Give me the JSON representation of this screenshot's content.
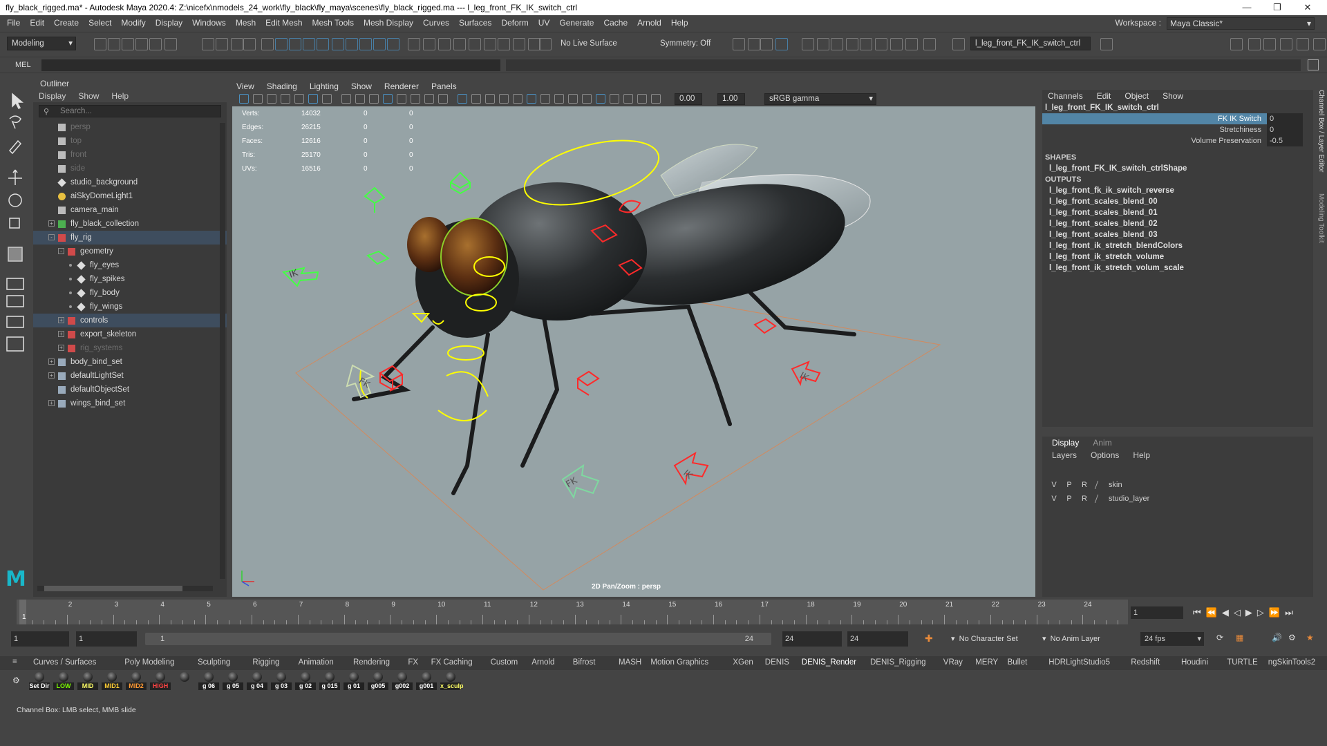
{
  "window": {
    "title": "fly_black_rigged.ma* - Autodesk Maya 2020.4: Z:\\nicefx\\nmodels_24_work\\fly_black\\fly_maya\\scenes\\fly_black_rigged.ma  ---  l_leg_front_FK_IK_switch_ctrl"
  },
  "menubar": {
    "items": [
      "File",
      "Edit",
      "Create",
      "Select",
      "Modify",
      "Display",
      "Windows",
      "Mesh",
      "Edit Mesh",
      "Mesh Tools",
      "Mesh Display",
      "Curves",
      "Surfaces",
      "Deform",
      "UV",
      "Generate",
      "Cache",
      "Arnold",
      "Help"
    ],
    "workspace_label": "Workspace :",
    "workspace_value": "Maya Classic*"
  },
  "statusline": {
    "menuset": "Modeling",
    "live_surface": "No Live Surface",
    "symmetry": "Symmetry: Off",
    "selection_field": "l_leg_front_FK_IK_switch_ctrl"
  },
  "mel": {
    "label": "MEL"
  },
  "outliner": {
    "title": "Outliner",
    "menu": [
      "Display",
      "Show",
      "Help"
    ],
    "search_placeholder": "Search...",
    "items": [
      {
        "label": "persp",
        "indent": 0,
        "icon": "camera",
        "dim": true
      },
      {
        "label": "top",
        "indent": 0,
        "icon": "camera",
        "dim": true
      },
      {
        "label": "front",
        "indent": 0,
        "icon": "camera",
        "dim": true
      },
      {
        "label": "side",
        "indent": 0,
        "icon": "camera",
        "dim": true
      },
      {
        "label": "studio_background",
        "indent": 0,
        "icon": "mesh"
      },
      {
        "label": "aiSkyDomeLight1",
        "indent": 0,
        "icon": "light"
      },
      {
        "label": "camera_main",
        "indent": 0,
        "icon": "camera"
      },
      {
        "label": "fly_black_collection",
        "indent": 0,
        "icon": "collection",
        "expand": "+"
      },
      {
        "label": "fly_rig",
        "indent": 0,
        "icon": "group",
        "expand": "-",
        "selected": true
      },
      {
        "label": "geometry",
        "indent": 1,
        "icon": "group",
        "expand": "-"
      },
      {
        "label": "fly_eyes",
        "indent": 2,
        "icon": "mesh"
      },
      {
        "label": "fly_spikes",
        "indent": 2,
        "icon": "mesh"
      },
      {
        "label": "fly_body",
        "indent": 2,
        "icon": "mesh"
      },
      {
        "label": "fly_wings",
        "indent": 2,
        "icon": "mesh"
      },
      {
        "label": "controls",
        "indent": 1,
        "icon": "group",
        "expand": "+",
        "selected": true
      },
      {
        "label": "export_skeleton",
        "indent": 1,
        "icon": "group",
        "expand": "+"
      },
      {
        "label": "rig_systems",
        "indent": 1,
        "icon": "group",
        "expand": "+",
        "dim": true
      },
      {
        "label": "body_bind_set",
        "indent": 0,
        "icon": "set",
        "expand": "+"
      },
      {
        "label": "defaultLightSet",
        "indent": 0,
        "icon": "set",
        "expand": "+"
      },
      {
        "label": "defaultObjectSet",
        "indent": 0,
        "icon": "set"
      },
      {
        "label": "wings_bind_set",
        "indent": 0,
        "icon": "set",
        "expand": "+"
      }
    ]
  },
  "viewport": {
    "menu": [
      "View",
      "Shading",
      "Lighting",
      "Show",
      "Renderer",
      "Panels"
    ],
    "field_a": "0.00",
    "field_b": "1.00",
    "colorspace": "sRGB gamma",
    "hud": [
      {
        "label": "Verts:",
        "v1": "14032",
        "v2": "0",
        "v3": "0"
      },
      {
        "label": "Edges:",
        "v1": "26215",
        "v2": "0",
        "v3": "0"
      },
      {
        "label": "Faces:",
        "v1": "12616",
        "v2": "0",
        "v3": "0"
      },
      {
        "label": "Tris:",
        "v1": "25170",
        "v2": "0",
        "v3": "0"
      },
      {
        "label": "UVs:",
        "v1": "16516",
        "v2": "0",
        "v3": "0"
      }
    ],
    "camera_label": "2D Pan/Zoom : persp",
    "ik_label": "IK",
    "fk_label": "FK"
  },
  "channelbox": {
    "menu": [
      "Channels",
      "Edit",
      "Object",
      "Show"
    ],
    "node": "l_leg_front_FK_IK_switch_ctrl",
    "attrs": [
      {
        "name": "FK IK Switch",
        "value": "0"
      },
      {
        "name": "Stretchiness",
        "value": "0"
      },
      {
        "name": "Volume Preservation",
        "value": "-0.5"
      }
    ],
    "shapes_header": "SHAPES",
    "shape": "l_leg_front_FK_IK_switch_ctrlShape",
    "outputs_header": "OUTPUTS",
    "outputs": [
      "l_leg_front_fk_ik_switch_reverse",
      "l_leg_front_scales_blend_00",
      "l_leg_front_scales_blend_01",
      "l_leg_front_scales_blend_02",
      "l_leg_front_scales_blend_03",
      "l_leg_front_ik_stretch_blendColors",
      "l_leg_front_ik_stretch_volume",
      "l_leg_front_ik_stretch_volum_scale"
    ]
  },
  "layers": {
    "tabs": [
      "Display",
      "Anim"
    ],
    "menu": [
      "Layers",
      "Options",
      "Help"
    ],
    "rows": [
      {
        "v": "V",
        "p": "P",
        "r": "R",
        "name": "skin"
      },
      {
        "v": "V",
        "p": "P",
        "r": "R",
        "name": "studio_layer"
      }
    ]
  },
  "sidetabs": [
    "Channel Box / Layer Editor",
    "Modeling Toolkit"
  ],
  "timeslider": {
    "ticks": [
      "1",
      "2",
      "3",
      "4",
      "5",
      "6",
      "7",
      "8",
      "9",
      "10",
      "11",
      "12",
      "13",
      "14",
      "15",
      "16",
      "17",
      "18",
      "19",
      "20",
      "21",
      "22",
      "23",
      "24"
    ],
    "current": "1",
    "current_field": "1"
  },
  "range": {
    "start": "1",
    "anim_start": "1",
    "slider_start": "1",
    "slider_end": "24",
    "anim_end": "24",
    "end": "24",
    "character_set": "No Character Set",
    "anim_layer": "No Anim Layer",
    "fps": "24 fps"
  },
  "shelf": {
    "tabs": [
      "Curves / Surfaces",
      "Poly Modeling",
      "Sculpting",
      "Rigging",
      "Animation",
      "Rendering",
      "FX",
      "FX Caching",
      "Custom",
      "Arnold",
      "Bifrost",
      "MASH",
      "Motion Graphics",
      "XGen",
      "DENIS",
      "DENIS_Render",
      "DENIS_Rigging",
      "VRay",
      "MERY",
      "Bullet",
      "HDRLightStudio5",
      "Redshift",
      "Houdini",
      "TURTLE",
      "ngSkinTools2"
    ],
    "active_tab": "DENIS_Render",
    "buttons": [
      {
        "label": "Set Dir",
        "color": "#ffffff"
      },
      {
        "label": "LOW",
        "color": "#7cfc00"
      },
      {
        "label": "MID",
        "color": "#ffff66"
      },
      {
        "label": "MID1",
        "color": "#ffcc33"
      },
      {
        "label": "MID2",
        "color": "#ff9933"
      },
      {
        "label": "HIGH",
        "color": "#ff4444"
      },
      {
        "label": "",
        "color": "#66ccff"
      },
      {
        "label": "g 06",
        "color": "#ffffff"
      },
      {
        "label": "g 05",
        "color": "#ffffff"
      },
      {
        "label": "g 04",
        "color": "#ffffff"
      },
      {
        "label": "g 03",
        "color": "#ffffff"
      },
      {
        "label": "g 02",
        "color": "#ffffff"
      },
      {
        "label": "g 015",
        "color": "#ffffff"
      },
      {
        "label": "g 01",
        "color": "#ffffff"
      },
      {
        "label": "g005",
        "color": "#ffffff"
      },
      {
        "label": "g002",
        "color": "#ffffff"
      },
      {
        "label": "g001",
        "color": "#ffffff"
      },
      {
        "label": "x_sculp",
        "color": "#ffff66"
      }
    ]
  },
  "helpline": {
    "text": "Channel Box: LMB select, MMB slide"
  },
  "colors": {
    "selection": "#5285a6",
    "accent": "#3e4d5e",
    "rig_yellow": "#ffff00",
    "rig_red": "#ff2a2a",
    "rig_green": "#44ff44"
  }
}
